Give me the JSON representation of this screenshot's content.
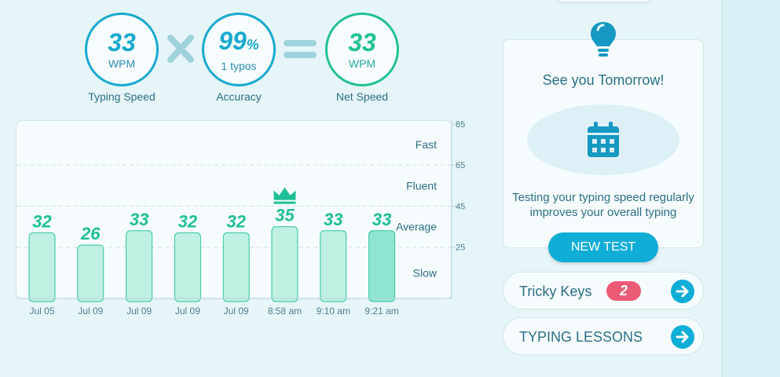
{
  "metrics": {
    "typing_speed": {
      "value": "33",
      "unit": "WPM",
      "caption": "Typing Speed"
    },
    "accuracy": {
      "value": "99",
      "unit": "%",
      "typos": "1 typos",
      "caption": "Accuracy"
    },
    "net_speed": {
      "value": "33",
      "unit": "WPM",
      "caption": "Net Speed"
    },
    "operators": {
      "multiply": "multiply-icon",
      "equals": "equals-icon"
    }
  },
  "chart_data": {
    "type": "bar",
    "categories": [
      "Jul 05",
      "Jul 09",
      "Jul 09",
      "Jul 09",
      "Jul 09",
      "8:58 am",
      "9:10 am",
      "9:21 am"
    ],
    "values": [
      32,
      26,
      33,
      32,
      32,
      35,
      33,
      33
    ],
    "best_index": 5,
    "latest_index": 7,
    "ylim": [
      0,
      85
    ],
    "yticks": [
      25,
      45,
      65,
      85
    ],
    "levels": [
      "Slow",
      "Average",
      "Fluent",
      "Fast"
    ],
    "grid": true,
    "colors": {
      "bar": "#bff0e2",
      "bar_latest": "#8ee6d1",
      "bar_stroke": "#2dc69b",
      "label": "#1fbf96",
      "crown": "#1fbf96"
    }
  },
  "panel": {
    "icon": "lightbulb-icon",
    "title": "See you Tomorrow!",
    "calendar_icon": "calendar-icon",
    "text_line1": "Testing your typing speed regularly",
    "text_line2": "improves your overall typing",
    "new_test_label": "NEW TEST"
  },
  "tricky_keys": {
    "label": "Tricky Keys",
    "count": "2"
  },
  "typing_lessons": {
    "label": "TYPING LESSONS"
  },
  "colors": {
    "blue": "#19a9d0",
    "green": "#22c195",
    "accent_button": "#10add6",
    "badge": "#ec5b76"
  }
}
